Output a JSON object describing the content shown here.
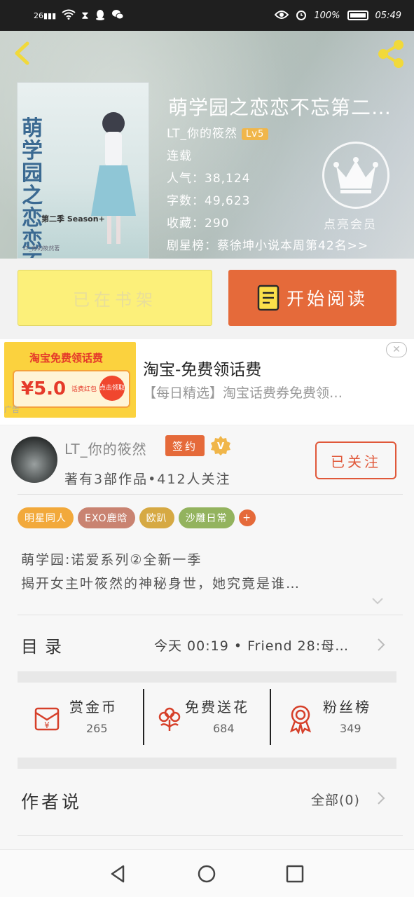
{
  "status_bar": {
    "network": "26",
    "battery": "100%",
    "time": "05:49"
  },
  "book": {
    "title": "萌学园之恋恋不忘第二…",
    "author": "LT_你的筱然",
    "level": "Lv5",
    "status": "连载",
    "popularity_label": "人气：",
    "popularity": "38,124",
    "words_label": "字数：",
    "words": "49,623",
    "collect_label": "收藏：",
    "collect": "290",
    "ranking": "剧星榜：蔡徐坤小说本周第42名>>",
    "vip_text": "点亮会员",
    "cover": {
      "title": "萌学园之恋恋不忘",
      "season": "第二季 Season+",
      "author_tag": "LT_你的筱然著"
    }
  },
  "actions": {
    "shelf": "已在书架",
    "read": "开始阅读"
  },
  "ad": {
    "banner_title": "淘宝免费领话费",
    "amount": "¥5.0",
    "coupon_label": "话费红包",
    "tap_label": "点击领取",
    "title": "淘宝-免费领话费",
    "desc": "【每日精选】淘宝话费券免费领…",
    "close": "✕",
    "tag": "广告"
  },
  "author": {
    "name": "LT_你的筱然",
    "sign_badge": "签约",
    "stats_line": "著有3部作品•412人关注",
    "follow": "已关注"
  },
  "tags": [
    {
      "label": "明星同人",
      "color": "#f2a93b"
    },
    {
      "label": "EXO鹿晗",
      "color": "#c98371"
    },
    {
      "label": "欧趴",
      "color": "#d6a943"
    },
    {
      "label": "沙雕日常",
      "color": "#93b35e"
    },
    {
      "label": "+",
      "color": "#e56a3a"
    }
  ],
  "description": [
    "萌学园:诺爱系列②全新一季",
    "揭开女主叶筱然的神秘身世，她究竟是谁…"
  ],
  "toc": {
    "label": "目录",
    "latest": "今天 00:19 • Friend 28:母…"
  },
  "stats": [
    {
      "label": "赏金币",
      "value": "265",
      "icon": "red-envelope-icon"
    },
    {
      "label": "免费送花",
      "value": "684",
      "icon": "flower-icon"
    },
    {
      "label": "粉丝榜",
      "value": "349",
      "icon": "medal-icon"
    }
  ],
  "author_say": {
    "label": "作者说",
    "all": "全部(0)"
  },
  "colors": {
    "accent": "#e56a3a",
    "shelf_button": "#fcf07a",
    "vip_badge": "#f0b64a"
  }
}
